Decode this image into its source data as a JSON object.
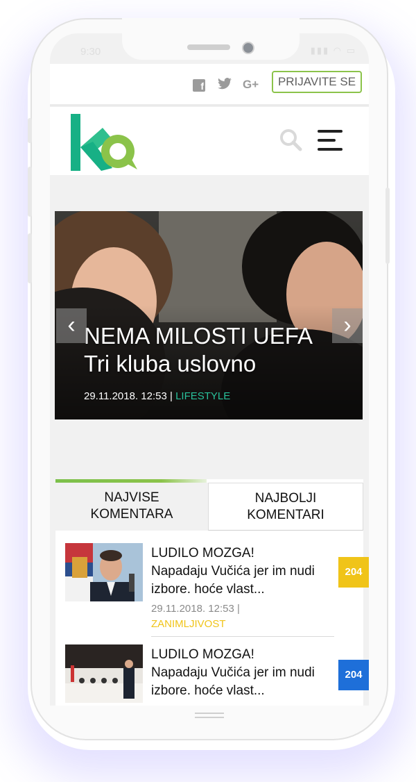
{
  "status": {
    "time": "9:30"
  },
  "topbar": {
    "social": [
      "facebook-icon",
      "twitter-icon",
      "google-plus-icon"
    ],
    "google_label": "G+",
    "login_label": "PRIJAVITE SE"
  },
  "brand": {
    "accent": "#8bc34a",
    "logo_teal": "#17b085",
    "logo_green": "#8bc34a"
  },
  "slider": {
    "title_line1": "NEMA MILOSTI UEFA",
    "title_line2": "Tri kluba uslovno",
    "date": "29.11.2018. 12:53 |",
    "category": "LIFESTYLE"
  },
  "tabs": {
    "t1_line1": "NAJVISE",
    "t1_line2": "KOMENTARA",
    "t2_line1": "NAJBOLJI",
    "t2_line2": "KOMENTARI"
  },
  "articles": [
    {
      "title1": "LUDILO MOZGA!",
      "title2": "Napadaju Vučića jer im nudi",
      "title3": "izbore. hoće vlast...",
      "date": "29.11.2018. 12:53 |",
      "category": "ZANIMLJIVOST",
      "count": "204",
      "badge_color": "#f0c419"
    },
    {
      "title1": "LUDILO MOZGA!",
      "title2": "Napadaju Vučića jer im nudi",
      "title3": "izbore. hoće vlast...",
      "count": "204",
      "badge_color": "#1e6fd9"
    }
  ]
}
